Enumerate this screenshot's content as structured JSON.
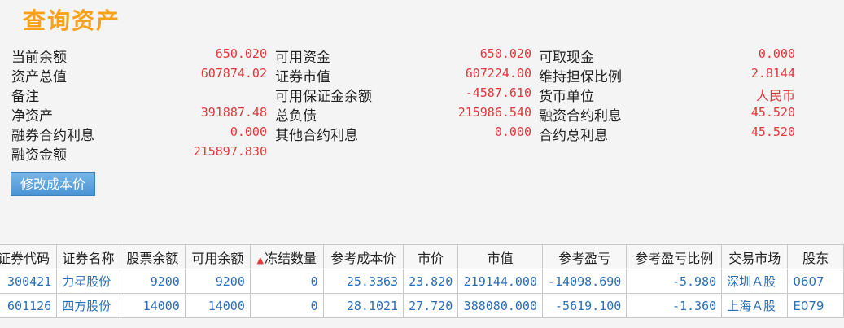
{
  "page": {
    "title": "查询资产"
  },
  "summary": [
    [
      {
        "label": "当前余额",
        "value": "650.020"
      },
      {
        "label": "可用资金",
        "value": "650.020"
      },
      {
        "label": "可取现金",
        "value": "0.000"
      }
    ],
    [
      {
        "label": "资产总值",
        "value": "607874.02"
      },
      {
        "label": "证券市值",
        "value": "607224.00"
      },
      {
        "label": "维持担保比例",
        "value": "2.8144"
      }
    ],
    [
      {
        "label": "备注",
        "value": ""
      },
      {
        "label": "可用保证金余额",
        "value": "-4587.610"
      },
      {
        "label": "货币单位",
        "value": "人民币"
      }
    ],
    [
      {
        "label": "净资产",
        "value": "391887.48"
      },
      {
        "label": "总负债",
        "value": "215986.540"
      },
      {
        "label": "融资合约利息",
        "value": "45.520"
      }
    ],
    [
      {
        "label": "融券合约利息",
        "value": "0.000"
      },
      {
        "label": "其他合约利息",
        "value": "0.000"
      },
      {
        "label": "合约总利息",
        "value": "45.520"
      }
    ],
    [
      {
        "label": "融资金额",
        "value": "215897.830"
      },
      {
        "label": "",
        "value": ""
      },
      {
        "label": "",
        "value": ""
      }
    ]
  ],
  "buttons": {
    "edit_cost": "修改成本价"
  },
  "table": {
    "sort_indicator": "▲",
    "columns": [
      "证券代码",
      "证券名称",
      "股票余额",
      "可用余额",
      "冻结数量",
      "参考成本价",
      "市价",
      "市值",
      "参考盈亏",
      "参考盈亏比例",
      "交易市场",
      "股东"
    ],
    "rows": [
      [
        "300421",
        "力星股份",
        "9200",
        "9200",
        "0",
        "25.3363",
        "23.820",
        "219144.000",
        "-14098.690",
        "-5.980",
        "深圳Ａ股",
        "0607"
      ],
      [
        "601126",
        "四方股份",
        "14000",
        "14000",
        "0",
        "28.1021",
        "27.720",
        "388080.000",
        "-5619.100",
        "-1.360",
        "上海Ａ股",
        "E079"
      ]
    ]
  }
}
